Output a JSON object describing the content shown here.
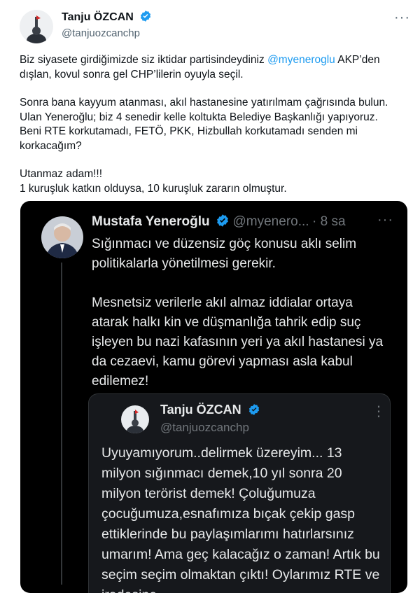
{
  "tweet": {
    "author_name": "Tanju ÖZCAN",
    "author_handle": "@tanjuozcanchp",
    "verified_icon": "verified-badge-icon",
    "menu_icon": "more-icon",
    "menu_label": "···",
    "paragraphs": [
      {
        "before": "Biz siyasete girdiğimizde siz iktidar partisindeydiniz ",
        "mention": "@myeneroglu",
        "after": " AKP’den dışlan, kovul sonra gel CHP’lilerin oyuyla seçil."
      },
      {
        "text": "Sonra bana kayyum atanması, akıl hastanesine yatırılmam çağrısında bulun. Ulan Yeneroğlu; biz 4 senedir kelle koltukta Belediye Başkanlığı yapıyoruz. Beni RTE korkutamadı, FETÖ, PKK, Hizbullah korkutamadı senden mi korkacağım?"
      },
      {
        "line1": "Utanmaz adam!!!",
        "line2": "1 kuruşluk katkın olduysa, 10 kuruşluk zararın olmuştur."
      }
    ]
  },
  "embedded": {
    "author_name": "Mustafa Yeneroğlu",
    "author_handle": "@myenero...",
    "time": "· 8 sa",
    "menu_label": "···",
    "paragraphs": [
      "Sığınmacı ve düzensiz göç konusu aklı selim politikalarla yönetilmesi gerekir.",
      "Mesnetsiz verilerle akıl almaz iddialar ortaya atarak halkı kin ve düşmanlığa tahrik edip suç işleyen bu nazi kafasının yeri ya akıl hastanesi ya da cezaevi, kamu görevi yapması asla kabul edilemez!"
    ],
    "quoted": {
      "author_name": "Tanju ÖZCAN",
      "author_handle": "@tanjuozcanchp",
      "menu_label": "⋮",
      "text": "Uyuyamıyorum..delirmek üzereyim... 13 milyon sığınmacı demek,10 yıl sonra 20 milyon terörist demek! Çoluğumuza çocuğumuza,esnafımıza bıçak çekip gasp ettiklerinde bu  paylaşımlarımı hatırlarsınız umarım! Ama geç kalacağız o zaman! Artık bu seçim seçim olmaktan çıktı! Oylarımız RTE ve iradesine"
    }
  },
  "colors": {
    "link": "#1d9bf0",
    "verified": "#1d9bf0",
    "embed_bg": "#000000",
    "embed_text": "#e7e9ea",
    "embed_muted": "#71767b"
  }
}
